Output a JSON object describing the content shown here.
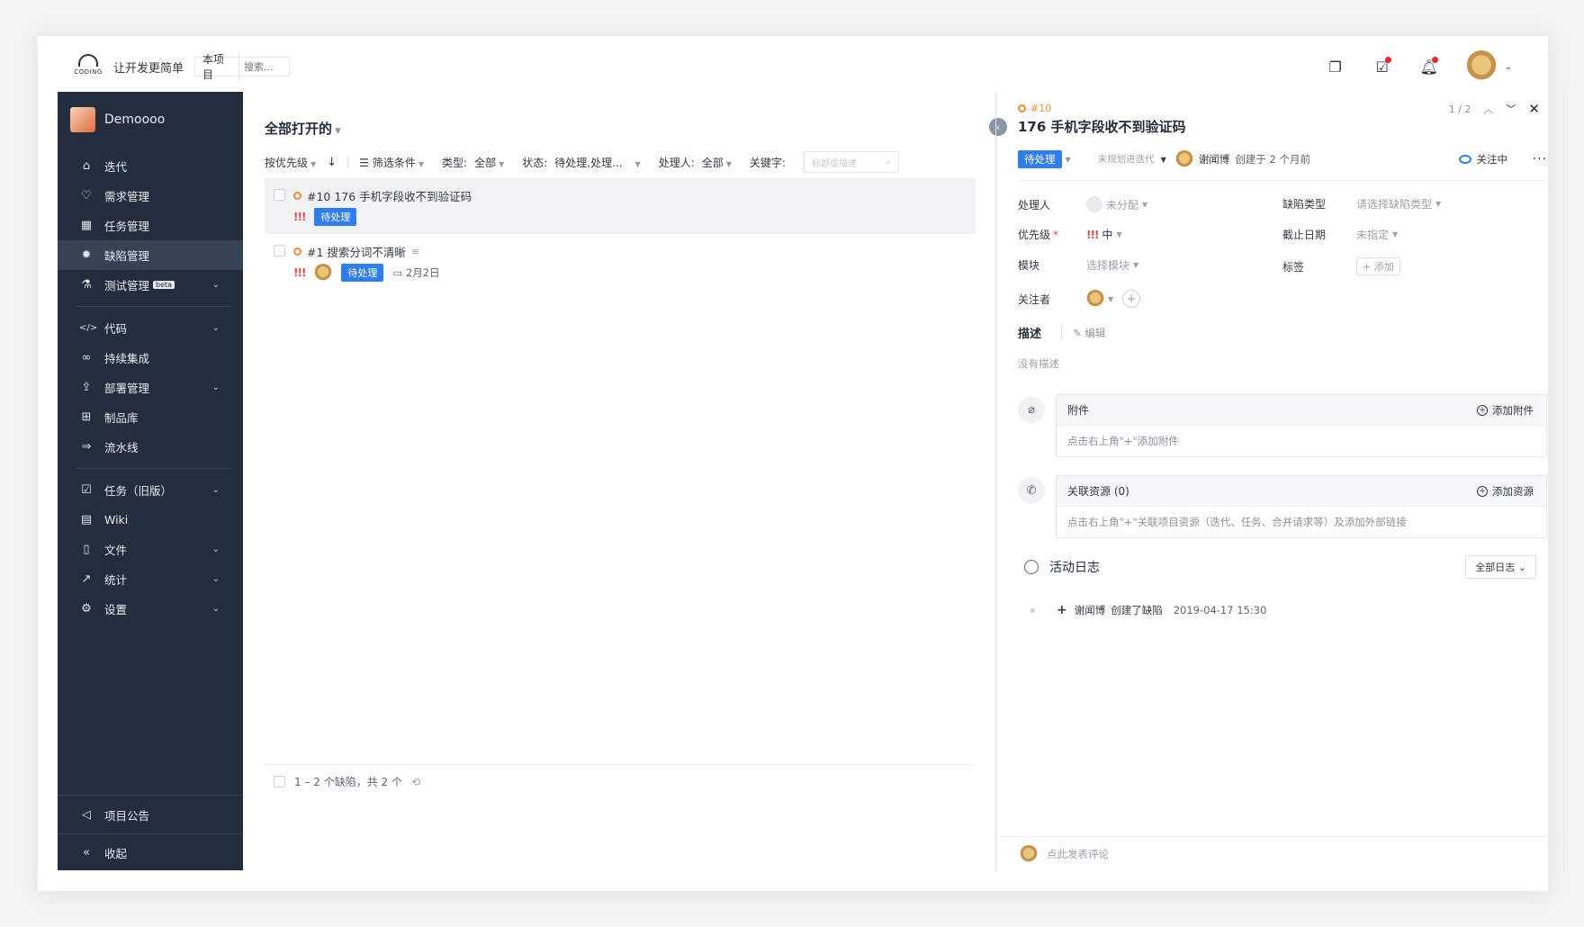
{
  "topbar": {
    "logo_text": "CODING",
    "slogan": "让开发更简单",
    "scope_label": "本项目",
    "search_placeholder": "搜索..."
  },
  "sidebar": {
    "project_name": "Demoooo",
    "items": [
      {
        "label": "迭代",
        "icon": "iteration-icon",
        "glyph": "⌂"
      },
      {
        "label": "需求管理",
        "icon": "lightbulb-icon",
        "glyph": "♡"
      },
      {
        "label": "任务管理",
        "icon": "task-board-icon",
        "glyph": "▦"
      },
      {
        "label": "缺陷管理",
        "icon": "bug-icon",
        "glyph": "✹"
      },
      {
        "label": "测试管理",
        "icon": "flask-icon",
        "glyph": "⚗",
        "badge": "beta"
      },
      {
        "label": "代码",
        "icon": "code-icon",
        "glyph": "</>"
      },
      {
        "label": "持续集成",
        "icon": "infinity-icon",
        "glyph": "∞"
      },
      {
        "label": "部署管理",
        "icon": "rocket-icon",
        "glyph": "⇪"
      },
      {
        "label": "制品库",
        "icon": "artifact-icon",
        "glyph": "⊞"
      },
      {
        "label": "流水线",
        "icon": "pipeline-icon",
        "glyph": "⇒"
      },
      {
        "label": "任务（旧版）",
        "icon": "checkbox-icon",
        "glyph": "☑"
      },
      {
        "label": "Wiki",
        "icon": "wiki-icon",
        "glyph": "▤"
      },
      {
        "label": "文件",
        "icon": "file-icon",
        "glyph": "▯"
      },
      {
        "label": "统计",
        "icon": "chart-icon",
        "glyph": "↗"
      },
      {
        "label": "设置",
        "icon": "gear-icon",
        "glyph": "⚙"
      }
    ],
    "announcement": "项目公告",
    "collapse": "收起"
  },
  "list": {
    "title": "全部打开的",
    "sort": "按优先级",
    "filter": "筛选条件",
    "type_label": "类型:",
    "type_value": "全部",
    "status_label": "状态:",
    "status_value": "待处理,处理...",
    "assignee_label": "处理人:",
    "assignee_value": "全部",
    "keyword_label": "关键字:",
    "keyword_placeholder": "标题或描述",
    "rows": [
      {
        "id_title": "#10 176 手机字段收不到验证码",
        "priority": "!!!",
        "status": "待处理"
      },
      {
        "id_title": "#1 搜索分词不清晰",
        "priority": "!!!",
        "status": "待处理",
        "due": "2月2日"
      }
    ],
    "footer": "1 – 2 个缺陷，共 2 个"
  },
  "detail": {
    "id": "#10",
    "title": "176 手机字段收不到验证码",
    "pager": "1 / 2",
    "status": "待处理",
    "iteration": "未规划进迭代",
    "creator": "谢闻博",
    "created_text": "创建于 2 个月前",
    "watch": "关注中",
    "fields": {
      "assignee_label": "处理人",
      "assignee_value": "未分配",
      "defect_type_label": "缺陷类型",
      "defect_type_value": "请选择缺陷类型",
      "priority_label": "优先级",
      "priority_marks": "!!!",
      "priority_value": "中",
      "deadline_label": "截止日期",
      "deadline_value": "未指定",
      "module_label": "模块",
      "module_value": "选择模块",
      "tags_label": "标签",
      "tags_add": "+ 添加",
      "followers_label": "关注者"
    },
    "desc_title": "描述",
    "desc_edit": "编辑",
    "desc_empty": "没有描述",
    "attachments": {
      "title": "附件",
      "add": "添加附件",
      "hint": "点击右上角\"+\"添加附件"
    },
    "resources": {
      "title": "关联资源 (0)",
      "add": "添加资源",
      "hint": "点击右上角\"+\"关联项目资源（迭代、任务、合并请求等）及添加外部链接"
    },
    "log": {
      "title": "活动日志",
      "filter": "全部日志",
      "entry_user": "谢闻博",
      "entry_action": "创建了缺陷",
      "entry_time": "2019-04-17 15:30"
    },
    "comment_placeholder": "点此发表评论"
  },
  "colors": {
    "sidebar_bg": "#232d3d",
    "accent": "#2f7ef1",
    "priority": "#e54b4b",
    "defect_ring": "#f08a34"
  }
}
